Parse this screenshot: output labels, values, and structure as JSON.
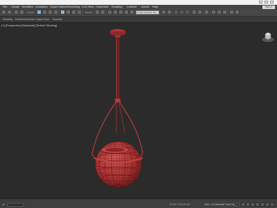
{
  "menu": {
    "items": [
      "File",
      "Create",
      "Modifiers",
      "Animation",
      "Graph Editors",
      "Rendering",
      "Civil View",
      "Customize",
      "Scripting",
      "Content",
      "Arnold",
      "Help"
    ],
    "sign_in": "Sign In"
  },
  "toolbar": {
    "selection_set": "Create Selection Set"
  },
  "ribbon": {
    "tabs": [
      "Modeling",
      "Freeform",
      "Selection",
      "Object Paint",
      "Populate"
    ]
  },
  "viewport": {
    "label": "[+] [Perspective] [Standard] [Default Shading]",
    "object_color": "#b83a3a",
    "background_color": "#2b2b2b"
  },
  "status": {
    "coords": "X: 0.0  Y: 0.0  Z: 0.0",
    "grid": "Grid = 10.0mm",
    "add_time_tag": "Add Time Tag",
    "frame": "0"
  }
}
